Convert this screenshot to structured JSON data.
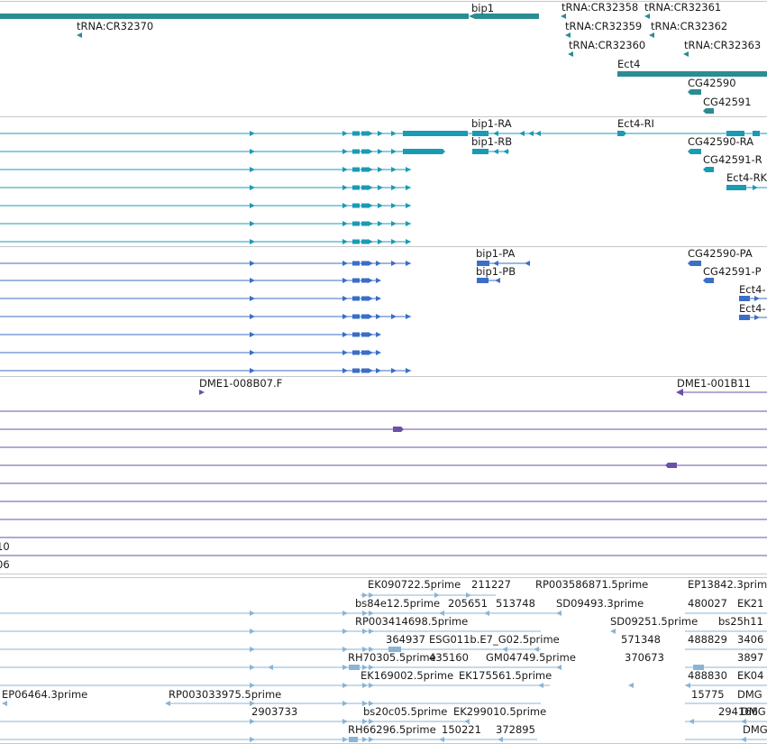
{
  "colors": {
    "gene": "#2b8c91",
    "transcript_a": "#1a9bb4",
    "transcript_b": "#3a6ec7",
    "cdna": "#6a50a8",
    "est": "#8ab4d6",
    "divider": "#c8c8c8",
    "label": "#1a1a1a"
  },
  "gene_track": {
    "labels": [
      "bip1",
      "tRNA:CR32370",
      "tRNA:CR32358",
      "tRNA:CR32361",
      "tRNA:CR32359",
      "tRNA:CR32362",
      "tRNA:CR32360",
      "tRNA:CR32363",
      "Ect4",
      "CG42590",
      "CG42591"
    ]
  },
  "transcript_track_1": {
    "labels": [
      "bip1-RA",
      "bip1-RB",
      "Ect4-RI",
      "CG42590-RA",
      "CG42591-R",
      "Ect4-RK"
    ]
  },
  "transcript_track_2": {
    "labels": [
      "bip1-PA",
      "bip1-PB",
      "CG42590-PA",
      "CG42591-P",
      "Ect4-",
      "Ect4-"
    ]
  },
  "cdna_track": {
    "labels": [
      "DME1-008B07.F",
      "DME1-001B11",
      "10",
      "06"
    ]
  },
  "est_track": {
    "labels": [
      "EK090722.5prime",
      "211227",
      "RP003586871.5prime",
      "EP13842.3prim",
      "bs84e12.5prime",
      "205651",
      "513748",
      "SD09493.3prime",
      "480027",
      "EK21",
      "RP003414698.5prime",
      "SD09251.5prime",
      "bs25h11",
      "364937",
      "ESG011b.E7_G02.5prime",
      "571348",
      "488829",
      "3406",
      "RH70305.5prime",
      "435160",
      "GM04749.5prime",
      "370673",
      "3897",
      "EK169002.5prime",
      "EK175561.5prime",
      "488830",
      "EK04",
      "EP06464.3prime",
      "RP003033975.5prime",
      "15775",
      "DMG",
      "2903733",
      "bs20c05.5prime",
      "EK299010.5prime",
      "294166",
      "DMG",
      "RH66296.5prime",
      "150221",
      "372895",
      "DMG"
    ]
  }
}
